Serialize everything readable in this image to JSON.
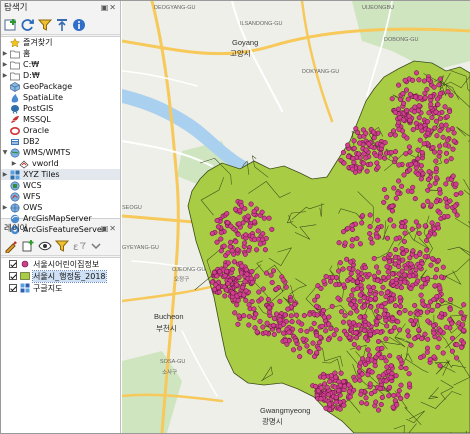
{
  "browser_panel": {
    "title": "탐색기",
    "toolbar": [
      "add-layer",
      "refresh",
      "filter",
      "collapse",
      "info"
    ],
    "items": [
      {
        "label": "즐겨찾기",
        "icon": "star-icon",
        "expand": "none"
      },
      {
        "label": "홈",
        "icon": "folder-icon",
        "expand": "collapsed"
      },
      {
        "label": "C:₩",
        "icon": "folder-icon",
        "expand": "collapsed"
      },
      {
        "label": "D:₩",
        "icon": "folder-icon",
        "expand": "collapsed"
      },
      {
        "label": "GeoPackage",
        "icon": "geopackage-icon",
        "expand": "none"
      },
      {
        "label": "SpatiaLite",
        "icon": "spatialite-icon",
        "expand": "none"
      },
      {
        "label": "PostGIS",
        "icon": "postgis-icon",
        "expand": "none"
      },
      {
        "label": "MSSQL",
        "icon": "mssql-icon",
        "expand": "none"
      },
      {
        "label": "Oracle",
        "icon": "oracle-icon",
        "expand": "none"
      },
      {
        "label": "DB2",
        "icon": "db2-icon",
        "expand": "none"
      },
      {
        "label": "WMS/WMTS",
        "icon": "wms-icon",
        "expand": "expanded"
      },
      {
        "label": "vworld",
        "icon": "wms-layer-icon",
        "expand": "collapsed",
        "indent": 1
      },
      {
        "label": "XYZ Tiles",
        "icon": "xyz-icon",
        "expand": "collapsed",
        "selected": true
      },
      {
        "label": "WCS",
        "icon": "wcs-icon",
        "expand": "none"
      },
      {
        "label": "WFS",
        "icon": "wfs-icon",
        "expand": "none"
      },
      {
        "label": "OWS",
        "icon": "ows-icon",
        "expand": "collapsed"
      },
      {
        "label": "ArcGisMapServer",
        "icon": "arcgis-map-icon",
        "expand": "none"
      },
      {
        "label": "ArcGisFeatureServer",
        "icon": "arcgis-feature-icon",
        "expand": "none"
      }
    ]
  },
  "layers_panel": {
    "title": "레이어",
    "toolbar": [
      "style",
      "add-group",
      "visibility",
      "filter",
      "filter-by-expression",
      "collapse-all"
    ],
    "layers": [
      {
        "name": "서울시어린이집정보",
        "checked": true,
        "symbol": "point",
        "color": "#d0408f",
        "selected": false
      },
      {
        "name": "서울시_행정동_2018",
        "checked": true,
        "symbol": "polygon",
        "color": "#a8cc44",
        "selected": true
      },
      {
        "name": "구글지도",
        "checked": true,
        "symbol": "raster",
        "color": "#2f5fb5",
        "selected": false
      }
    ]
  },
  "map": {
    "basemap_labels": [
      {
        "text": "DEOGYANG-GU",
        "kind": "district"
      },
      {
        "text": "Goyang",
        "kind": "city"
      },
      {
        "text": "고양시",
        "kind": "city-ko"
      },
      {
        "text": "ILSANDONG-GU",
        "kind": "district"
      },
      {
        "text": "DOKYANG-GU",
        "kind": "district"
      },
      {
        "text": "UIJEONGBU",
        "kind": "district"
      },
      {
        "text": "DOBONG-GU",
        "kind": "district"
      },
      {
        "text": "SEOGU",
        "kind": "district"
      },
      {
        "text": "GYEYANG-GU",
        "kind": "district"
      },
      {
        "text": "OJEONG-GU",
        "kind": "district"
      },
      {
        "text": "오정구",
        "kind": "district-ko"
      },
      {
        "text": "Bucheon",
        "kind": "city"
      },
      {
        "text": "부천시",
        "kind": "city-ko"
      },
      {
        "text": "SOSA-GU",
        "kind": "district"
      },
      {
        "text": "소사구",
        "kind": "district-ko"
      },
      {
        "text": "Gwangmyeong",
        "kind": "city"
      },
      {
        "text": "광명시",
        "kind": "city-ko"
      }
    ],
    "polygon_fill": "#a8cc44",
    "polygon_stroke": "#3d4a1c",
    "point_fill": "#d0408f",
    "point_stroke": "#5a1038"
  }
}
